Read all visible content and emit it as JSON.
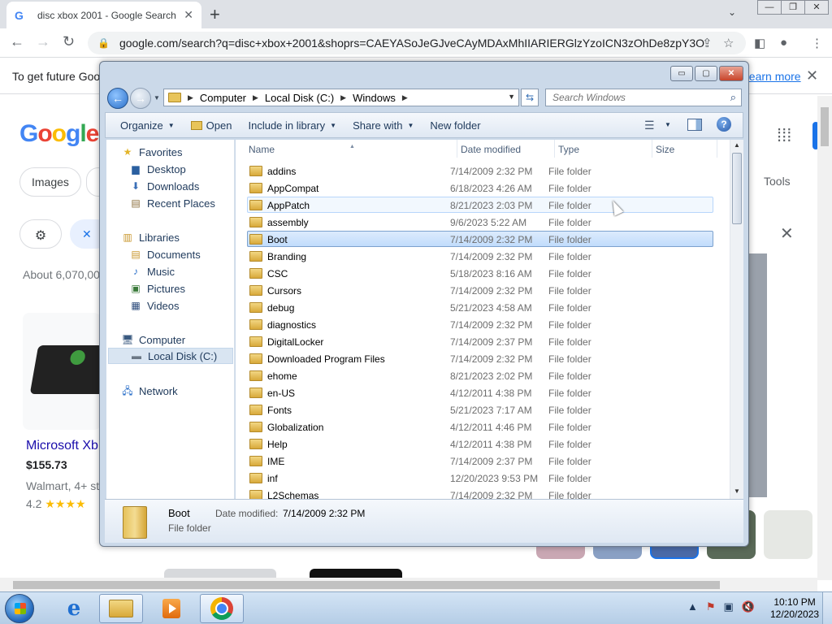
{
  "browser": {
    "tab_title": "disc xbox 2001 - Google Search",
    "tab_close": "✕",
    "new_tab": "+",
    "tab_menu": "⌄",
    "url": "google.com/search?q=disc+xbox+2001&shoprs=CAEYASoJeGJveCAyMDAxMhIIARIERGlzYzoICN3zOhDe8zpY3O...",
    "info_text": "To get future Goog",
    "learn_more": "Learn more",
    "info_close": "✕",
    "window_buttons": [
      "—",
      "❐",
      "✕"
    ]
  },
  "google": {
    "logo_letters": [
      "G",
      "o",
      "o",
      "g",
      "l",
      "e"
    ],
    "chip_images": "Images",
    "filters_icon": "⚙",
    "clear_icon": "✕",
    "results_count": "About 6,070,00",
    "tools": "Tools",
    "close_panel": "✕",
    "apps": "⋮⋮⋮",
    "product": {
      "title": "Microsoft Xb",
      "price": "$155.73",
      "store": "Walmart, 4+ st",
      "rating": "4.2",
      "stars": "★★★★"
    }
  },
  "explorer": {
    "caption_buttons": [
      "▭",
      "▢",
      "✕"
    ],
    "breadcrumb": [
      "Computer",
      "Local Disk (C:)",
      "Windows"
    ],
    "search_placeholder": "Search Windows",
    "commands": {
      "organize": "Organize",
      "open": "Open",
      "include_in_library": "Include in library",
      "share_with": "Share with",
      "new_folder": "New folder"
    },
    "nav": {
      "favorites": "Favorites",
      "desktop": "Desktop",
      "downloads": "Downloads",
      "recent_places": "Recent Places",
      "libraries": "Libraries",
      "documents": "Documents",
      "music": "Music",
      "pictures": "Pictures",
      "videos": "Videos",
      "computer": "Computer",
      "local_disk": "Local Disk (C:)",
      "network": "Network"
    },
    "columns": {
      "name": "Name",
      "date_modified": "Date modified",
      "type": "Type",
      "size": "Size"
    },
    "files": [
      {
        "name": "addins",
        "date": "7/14/2009 2:32 PM",
        "type": "File folder"
      },
      {
        "name": "AppCompat",
        "date": "6/18/2023 4:26 AM",
        "type": "File folder"
      },
      {
        "name": "AppPatch",
        "date": "8/21/2023 2:03 PM",
        "type": "File folder"
      },
      {
        "name": "assembly",
        "date": "9/6/2023 5:22 AM",
        "type": "File folder"
      },
      {
        "name": "Boot",
        "date": "7/14/2009 2:32 PM",
        "type": "File folder"
      },
      {
        "name": "Branding",
        "date": "7/14/2009 2:32 PM",
        "type": "File folder"
      },
      {
        "name": "CSC",
        "date": "5/18/2023 8:16 AM",
        "type": "File folder"
      },
      {
        "name": "Cursors",
        "date": "7/14/2009 2:32 PM",
        "type": "File folder"
      },
      {
        "name": "debug",
        "date": "5/21/2023 4:58 AM",
        "type": "File folder"
      },
      {
        "name": "diagnostics",
        "date": "7/14/2009 2:32 PM",
        "type": "File folder"
      },
      {
        "name": "DigitalLocker",
        "date": "7/14/2009 2:37 PM",
        "type": "File folder"
      },
      {
        "name": "Downloaded Program Files",
        "date": "7/14/2009 2:32 PM",
        "type": "File folder"
      },
      {
        "name": "ehome",
        "date": "8/21/2023 2:02 PM",
        "type": "File folder"
      },
      {
        "name": "en-US",
        "date": "4/12/2011 4:38 PM",
        "type": "File folder"
      },
      {
        "name": "Fonts",
        "date": "5/21/2023 7:17 AM",
        "type": "File folder"
      },
      {
        "name": "Globalization",
        "date": "4/12/2011 4:46 PM",
        "type": "File folder"
      },
      {
        "name": "Help",
        "date": "4/12/2011 4:38 PM",
        "type": "File folder"
      },
      {
        "name": "IME",
        "date": "7/14/2009 2:37 PM",
        "type": "File folder"
      },
      {
        "name": "inf",
        "date": "12/20/2023 9:53 PM",
        "type": "File folder"
      },
      {
        "name": "L2Schemas",
        "date": "7/14/2009 2:32 PM",
        "type": "File folder"
      }
    ],
    "hovered_index": 2,
    "selected_index": 4,
    "details": {
      "name": "Boot",
      "type": "File folder",
      "modified_label": "Date modified:",
      "modified_value": "7/14/2009 2:32 PM"
    }
  },
  "taskbar": {
    "time": "10:10 PM",
    "date": "12/20/2023",
    "tray_icons": [
      "▲",
      "⚑",
      "▣",
      "🔇"
    ]
  },
  "colors": {
    "selection": "#c1dcfc",
    "hover": "#f2f8fe",
    "google_blue": "#1a73e8"
  }
}
